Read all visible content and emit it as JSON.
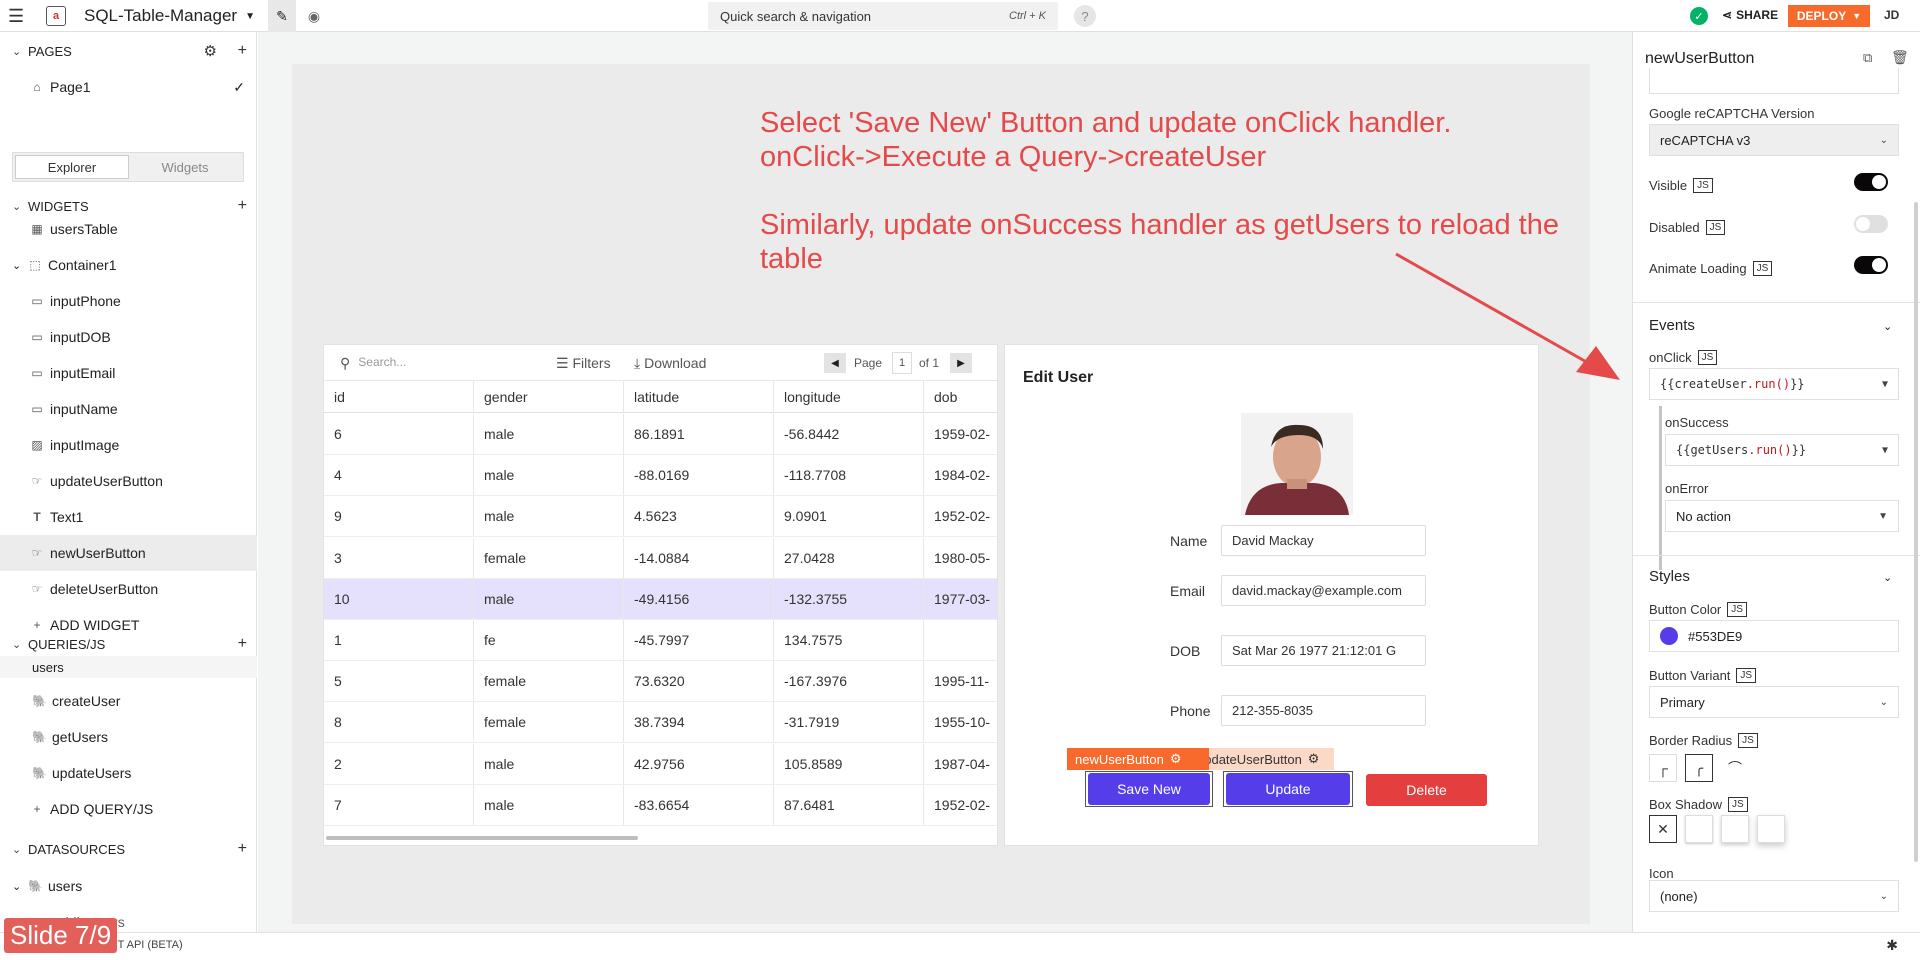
{
  "header": {
    "app_title": "SQL-Table-Manager",
    "search_placeholder": "Quick search & navigation",
    "search_shortcut": "Ctrl + K",
    "help": "?",
    "share_label": "SHARE",
    "deploy_label": "DEPLOY",
    "user_initials": "JD"
  },
  "sidebar": {
    "pages_heading": "PAGES",
    "pages": [
      "Page1"
    ],
    "tabs": [
      "Explorer",
      "Widgets"
    ],
    "widgets_heading": "WIDGETS",
    "widgets": [
      {
        "label": "usersTable",
        "icon": "table-icon"
      },
      {
        "label": "Container1",
        "icon": "container-icon"
      },
      {
        "label": "inputPhone",
        "icon": "input-icon"
      },
      {
        "label": "inputDOB",
        "icon": "input-icon"
      },
      {
        "label": "inputEmail",
        "icon": "input-icon"
      },
      {
        "label": "inputName",
        "icon": "input-icon"
      },
      {
        "label": "inputImage",
        "icon": "image-icon"
      },
      {
        "label": "updateUserButton",
        "icon": "button-icon"
      },
      {
        "label": "Text1",
        "icon": "text-icon"
      },
      {
        "label": "newUserButton",
        "icon": "button-icon"
      },
      {
        "label": "deleteUserButton",
        "icon": "button-icon"
      }
    ],
    "add_widget": "ADD WIDGET",
    "queries_heading": "QUERIES/JS",
    "queries_group": "users",
    "queries": [
      "createUser",
      "getUsers",
      "updateUsers"
    ],
    "add_query": "ADD QUERY/JS",
    "datasources_heading": "DATASOURCES",
    "datasources": [
      "users",
      "public.users"
    ],
    "connect_label": "CONNECT API (BETA)",
    "slide_badge": "Slide 7/9"
  },
  "annotation": {
    "line1": "Select 'Save New' Button and update onClick handler.",
    "line2": "onClick->Execute a Query->createUser",
    "line3": "Similarly, update onSuccess handler as getUsers to reload the table",
    "color": "#e44a4a"
  },
  "table": {
    "search_placeholder": "Search...",
    "filters_label": "Filters",
    "download_label": "Download",
    "page_label": "Page",
    "page_number": "1",
    "page_of": "of 1",
    "columns": [
      "id",
      "gender",
      "latitude",
      "longitude",
      "dob"
    ],
    "rows": [
      [
        "6",
        "male",
        "86.1891",
        "-56.8442",
        "1959-02-"
      ],
      [
        "4",
        "male",
        "-88.0169",
        "-118.7708",
        "1984-02-"
      ],
      [
        "9",
        "male",
        "4.5623",
        "9.0901",
        "1952-02-"
      ],
      [
        "3",
        "female",
        "-14.0884",
        "27.0428",
        "1980-05-"
      ],
      [
        "10",
        "male",
        "-49.4156",
        "-132.3755",
        "1977-03-"
      ],
      [
        "1",
        "fe",
        "-45.7997",
        "134.7575",
        ""
      ],
      [
        "5",
        "female",
        "73.6320",
        "-167.3976",
        "1995-11-"
      ],
      [
        "8",
        "female",
        "38.7394",
        "-31.7919",
        "1955-10-"
      ],
      [
        "2",
        "male",
        "42.9756",
        "105.8589",
        "1987-04-"
      ],
      [
        "7",
        "male",
        "-83.6654",
        "87.6481",
        "1952-02-"
      ]
    ],
    "selected_row_index": 4
  },
  "edit_user": {
    "title": "Edit User",
    "fields": [
      {
        "label": "Name",
        "value": "David Mackay"
      },
      {
        "label": "Email",
        "value": "david.mackay@example.com"
      },
      {
        "label": "DOB",
        "value": "Sat Mar 26 1977 21:12:01 G"
      },
      {
        "label": "Phone",
        "value": "212-355-8035"
      }
    ],
    "buttons": {
      "save": "Save New",
      "update": "Update",
      "delete": "Delete"
    },
    "tags": {
      "new_user": "newUserButton",
      "update_user": "updateUserButton"
    }
  },
  "property_pane": {
    "widget_name": "newUserButton",
    "recaptcha_label": "Google reCAPTCHA Version",
    "recaptcha_value": "reCAPTCHA v3",
    "toggles": [
      {
        "label": "Visible",
        "on": true
      },
      {
        "label": "Disabled",
        "on": false
      },
      {
        "label": "Animate Loading",
        "on": true
      }
    ],
    "js_tag": "JS",
    "events_heading": "Events",
    "onclick_label": "onClick",
    "onclick_value_open": "{{",
    "onclick_query": "createUser",
    "onclick_fn": ".run()",
    "onclick_value_close": "}}",
    "onsuccess_label": "onSuccess",
    "onsuccess_query": "getUsers",
    "onerror_label": "onError",
    "onerror_value": "No action",
    "styles_heading": "Styles",
    "button_color_label": "Button Color",
    "button_color_value": "#553DE9",
    "button_variant_label": "Button Variant",
    "button_variant_value": "Primary",
    "border_radius_label": "Border Radius",
    "box_shadow_label": "Box Shadow",
    "icon_label": "Icon",
    "icon_value": "(none)"
  },
  "colors": {
    "accent": "#553de9",
    "deploy": "#f86a2b",
    "delete": "#e43e3e",
    "tag": "#f86a2b",
    "success": "#03b365"
  }
}
